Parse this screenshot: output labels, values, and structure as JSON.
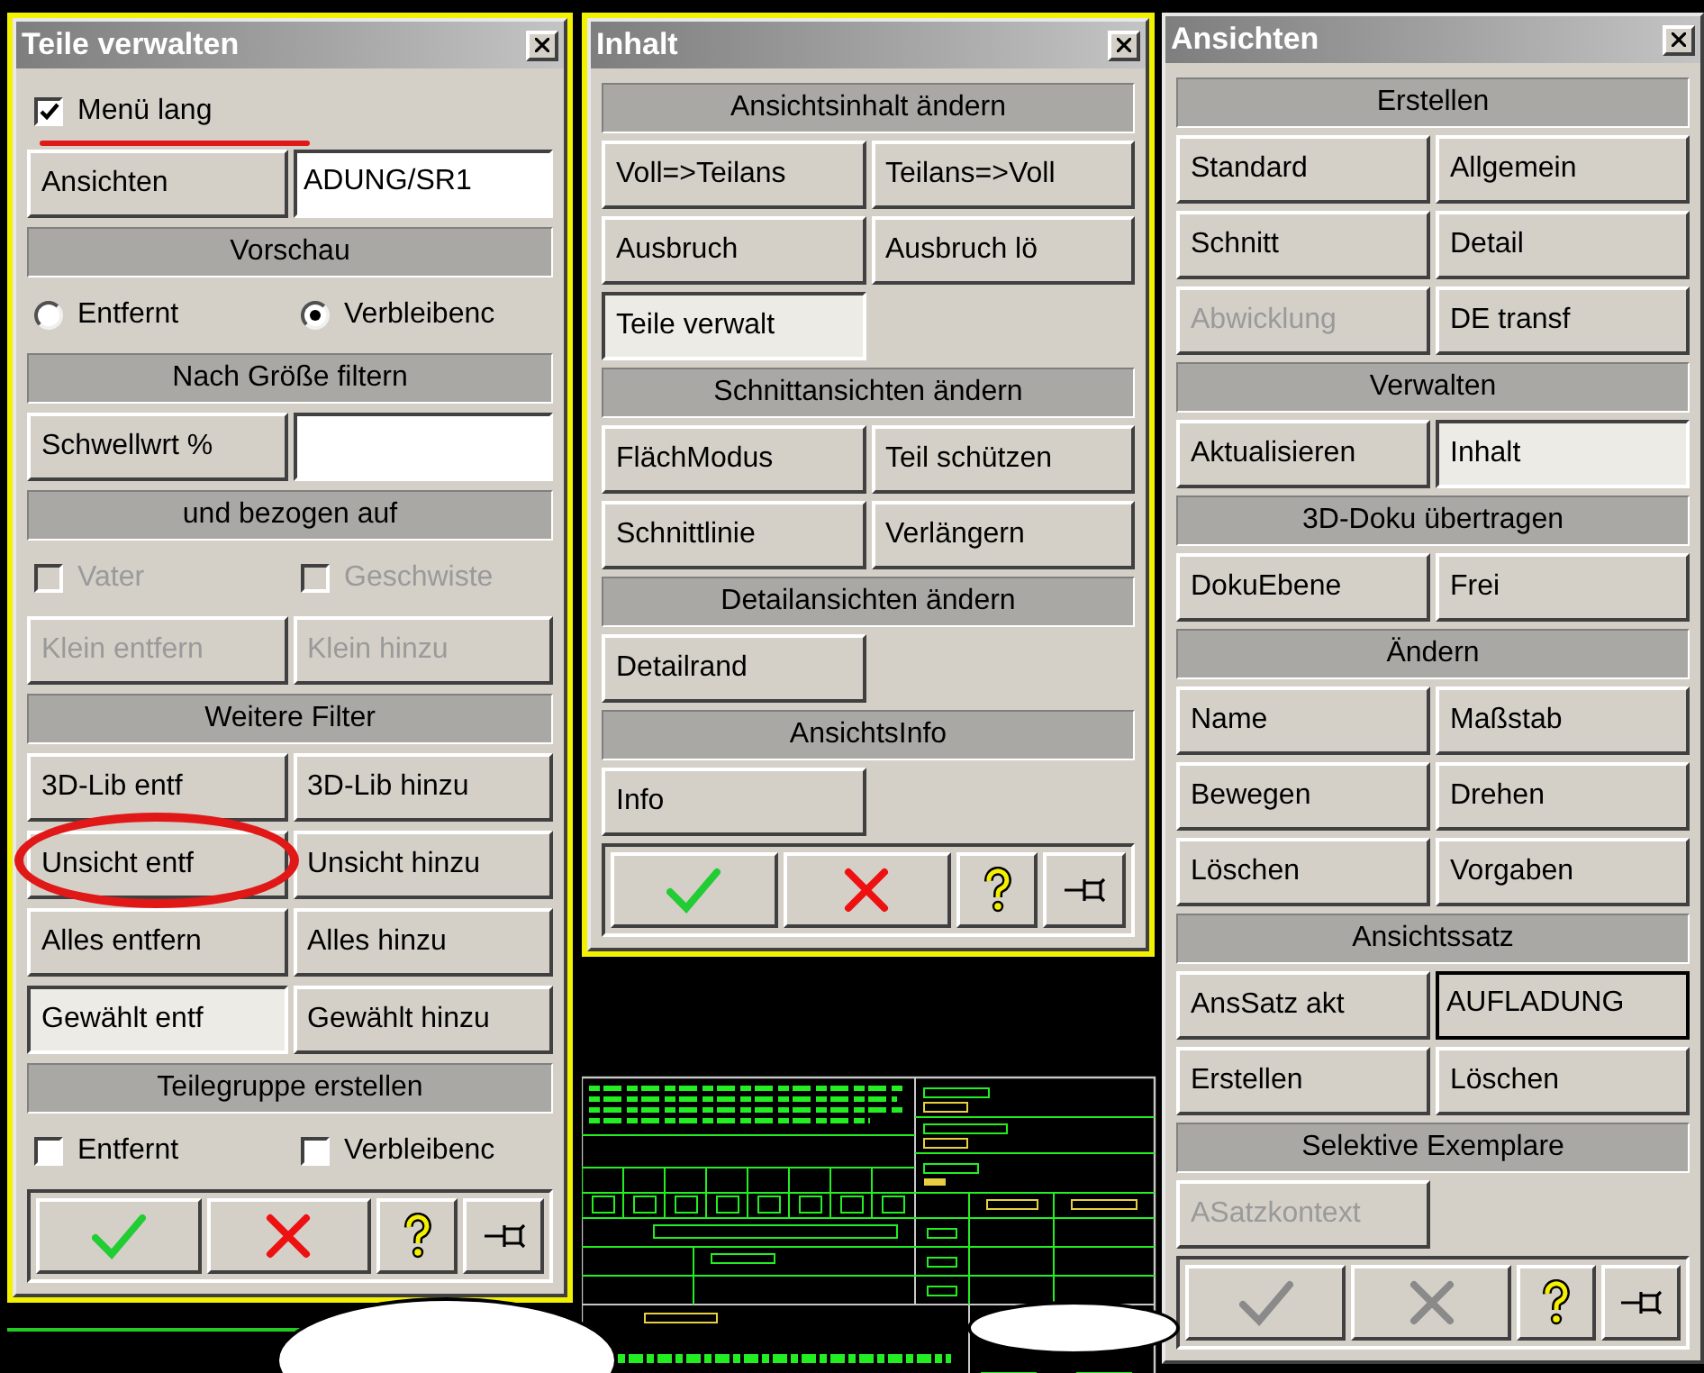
{
  "panels": [
    {
      "title": "Teile verwalten",
      "highlighted": true,
      "rows": [
        {
          "kind": "checks",
          "options": [
            {
              "label": "Menü lang",
              "checked": true,
              "disabled": false
            }
          ]
        },
        {
          "kind": "field",
          "button": "Ansichten",
          "value": "ADUNG/SR1",
          "readonly": false
        },
        {
          "kind": "header",
          "label": "Vorschau"
        },
        {
          "kind": "radios",
          "options": [
            {
              "label": "Entfernt",
              "selected": false
            },
            {
              "label": "Verbleibenc",
              "selected": true
            }
          ]
        },
        {
          "kind": "header",
          "label": "Nach Größe filtern"
        },
        {
          "kind": "field",
          "button": "Schwellwrt %",
          "readonly": false
        },
        {
          "kind": "header",
          "label": "und bezogen auf"
        },
        {
          "kind": "checks",
          "options": [
            {
              "label": "Vater",
              "checked": false,
              "disabled": true
            },
            {
              "label": "Geschwiste",
              "checked": false,
              "disabled": true
            }
          ]
        },
        {
          "kind": "buttons",
          "buttons": [
            {
              "label": "Klein entfern",
              "pressed": false,
              "disabled": true
            },
            {
              "label": "Klein hinzu",
              "pressed": false,
              "disabled": true
            }
          ]
        },
        {
          "kind": "header",
          "label": "Weitere Filter"
        },
        {
          "kind": "buttons",
          "buttons": [
            {
              "label": "3D-Lib entf",
              "pressed": false,
              "disabled": false
            },
            {
              "label": "3D-Lib hinzu",
              "pressed": false,
              "disabled": false
            }
          ]
        },
        {
          "kind": "buttons",
          "buttons": [
            {
              "label": "Unsicht entf",
              "pressed": false,
              "disabled": false
            },
            {
              "label": "Unsicht hinzu",
              "pressed": false,
              "disabled": false
            }
          ]
        },
        {
          "kind": "buttons",
          "buttons": [
            {
              "label": "Alles entfern",
              "pressed": false,
              "disabled": false
            },
            {
              "label": "Alles hinzu",
              "pressed": false,
              "disabled": false
            }
          ]
        },
        {
          "kind": "buttons",
          "buttons": [
            {
              "label": "Gewählt entf",
              "pressed": true,
              "disabled": false
            },
            {
              "label": "Gewählt hinzu",
              "pressed": false,
              "disabled": false
            }
          ]
        },
        {
          "kind": "header",
          "label": "Teilegruppe erstellen"
        },
        {
          "kind": "checks",
          "options": [
            {
              "label": "Entfernt",
              "checked": false,
              "disabled": false
            },
            {
              "label": "Verbleibenc",
              "checked": false,
              "disabled": false
            }
          ]
        },
        {
          "kind": "footer",
          "buttons": [
            {
              "kind": "ok",
              "disabled": false
            },
            {
              "kind": "cancel",
              "disabled": false
            },
            {
              "kind": "help",
              "disabled": false
            },
            {
              "kind": "pin",
              "disabled": false
            }
          ]
        }
      ]
    },
    {
      "title": "Inhalt",
      "highlighted": true,
      "rows": [
        {
          "kind": "header",
          "label": "Ansichtsinhalt ändern"
        },
        {
          "kind": "buttons",
          "buttons": [
            {
              "label": "Voll=>Teilans",
              "pressed": false,
              "disabled": false
            },
            {
              "label": "Teilans=>Voll",
              "pressed": false,
              "disabled": false
            }
          ]
        },
        {
          "kind": "buttons",
          "buttons": [
            {
              "label": "Ausbruch",
              "pressed": false,
              "disabled": false
            },
            {
              "label": "Ausbruch lö",
              "pressed": false,
              "disabled": false
            }
          ]
        },
        {
          "kind": "buttons",
          "buttons": [
            {
              "label": "Teile verwalt",
              "pressed": true,
              "disabled": false
            }
          ]
        },
        {
          "kind": "header",
          "label": "Schnittansichten ändern"
        },
        {
          "kind": "buttons",
          "buttons": [
            {
              "label": "FlächModus",
              "pressed": false,
              "disabled": false
            },
            {
              "label": "Teil schützen",
              "pressed": false,
              "disabled": false
            }
          ]
        },
        {
          "kind": "buttons",
          "buttons": [
            {
              "label": "Schnittlinie",
              "pressed": false,
              "disabled": false
            },
            {
              "label": "Verlängern",
              "pressed": false,
              "disabled": false
            }
          ]
        },
        {
          "kind": "header",
          "label": "Detailansichten ändern"
        },
        {
          "kind": "buttons",
          "buttons": [
            {
              "label": "Detailrand",
              "pressed": false,
              "disabled": false
            }
          ]
        },
        {
          "kind": "header",
          "label": "AnsichtsInfo"
        },
        {
          "kind": "buttons",
          "buttons": [
            {
              "label": "Info",
              "pressed": false,
              "disabled": false
            }
          ]
        },
        {
          "kind": "footer",
          "buttons": [
            {
              "kind": "ok",
              "disabled": false
            },
            {
              "kind": "cancel",
              "disabled": false
            },
            {
              "kind": "help",
              "disabled": false
            },
            {
              "kind": "pin",
              "disabled": false
            }
          ]
        }
      ]
    },
    {
      "title": "Ansichten",
      "highlighted": false,
      "rows": [
        {
          "kind": "header",
          "label": "Erstellen"
        },
        {
          "kind": "buttons",
          "buttons": [
            {
              "label": "Standard",
              "pressed": false,
              "disabled": false
            },
            {
              "label": "Allgemein",
              "pressed": false,
              "disabled": false
            }
          ]
        },
        {
          "kind": "buttons",
          "buttons": [
            {
              "label": "Schnitt",
              "pressed": false,
              "disabled": false
            },
            {
              "label": "Detail",
              "pressed": false,
              "disabled": false
            }
          ]
        },
        {
          "kind": "buttons",
          "buttons": [
            {
              "label": "Abwicklung",
              "pressed": false,
              "disabled": true
            },
            {
              "label": "DE transf",
              "pressed": false,
              "disabled": false
            }
          ]
        },
        {
          "kind": "header",
          "label": "Verwalten"
        },
        {
          "kind": "buttons",
          "buttons": [
            {
              "label": "Aktualisieren",
              "pressed": false,
              "disabled": false
            },
            {
              "label": "Inhalt",
              "pressed": true,
              "disabled": false
            }
          ]
        },
        {
          "kind": "header",
          "label": "3D-Doku übertragen"
        },
        {
          "kind": "buttons",
          "buttons": [
            {
              "label": "DokuEbene",
              "pressed": false,
              "disabled": false
            },
            {
              "label": "Frei",
              "pressed": false,
              "disabled": false
            }
          ]
        },
        {
          "kind": "header",
          "label": "Ändern"
        },
        {
          "kind": "buttons",
          "buttons": [
            {
              "label": "Name",
              "pressed": false,
              "disabled": false
            },
            {
              "label": "Maßstab",
              "pressed": false,
              "disabled": false
            }
          ]
        },
        {
          "kind": "buttons",
          "buttons": [
            {
              "label": "Bewegen",
              "pressed": false,
              "disabled": false
            },
            {
              "label": "Drehen",
              "pressed": false,
              "disabled": false
            }
          ]
        },
        {
          "kind": "buttons",
          "buttons": [
            {
              "label": "Löschen",
              "pressed": false,
              "disabled": false
            },
            {
              "label": "Vorgaben",
              "pressed": false,
              "disabled": false
            }
          ]
        },
        {
          "kind": "header",
          "label": "Ansichtssatz"
        },
        {
          "kind": "field",
          "button": "AnsSatz akt",
          "value": "AUFLADUNG",
          "readonly": true
        },
        {
          "kind": "buttons",
          "buttons": [
            {
              "label": "Erstellen",
              "pressed": false,
              "disabled": false
            },
            {
              "label": "Löschen",
              "pressed": false,
              "disabled": false
            }
          ]
        },
        {
          "kind": "header",
          "label": "Selektive Exemplare"
        },
        {
          "kind": "buttons",
          "buttons": [
            {
              "label": "ASatzkontext",
              "pressed": false,
              "disabled": true
            }
          ]
        },
        {
          "kind": "footer",
          "buttons": [
            {
              "kind": "ok",
              "disabled": true
            },
            {
              "kind": "cancel",
              "disabled": true
            },
            {
              "kind": "help",
              "disabled": false
            },
            {
              "kind": "pin",
              "disabled": false
            }
          ]
        }
      ]
    }
  ]
}
